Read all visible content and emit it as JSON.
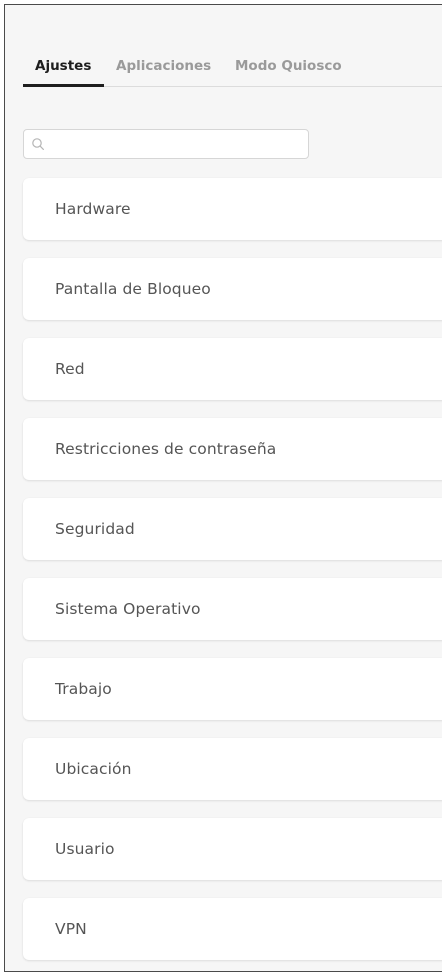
{
  "tabs": [
    {
      "label": "Ajustes",
      "active": true
    },
    {
      "label": "Aplicaciones",
      "active": false
    },
    {
      "label": "Modo Quiosco",
      "active": false
    }
  ],
  "search": {
    "placeholder": "",
    "value": "",
    "icon": "search-icon"
  },
  "settings_list": [
    {
      "label": "Hardware"
    },
    {
      "label": "Pantalla de Bloqueo"
    },
    {
      "label": "Red"
    },
    {
      "label": "Restricciones de contraseña"
    },
    {
      "label": "Seguridad"
    },
    {
      "label": "Sistema Operativo"
    },
    {
      "label": "Trabajo"
    },
    {
      "label": "Ubicación"
    },
    {
      "label": "Usuario"
    },
    {
      "label": "VPN"
    }
  ],
  "colors": {
    "background": "#f6f6f6",
    "card": "#ffffff",
    "active_tab": "#1e1e1e",
    "inactive_tab": "#9a9a9a",
    "item_text": "#555555"
  }
}
